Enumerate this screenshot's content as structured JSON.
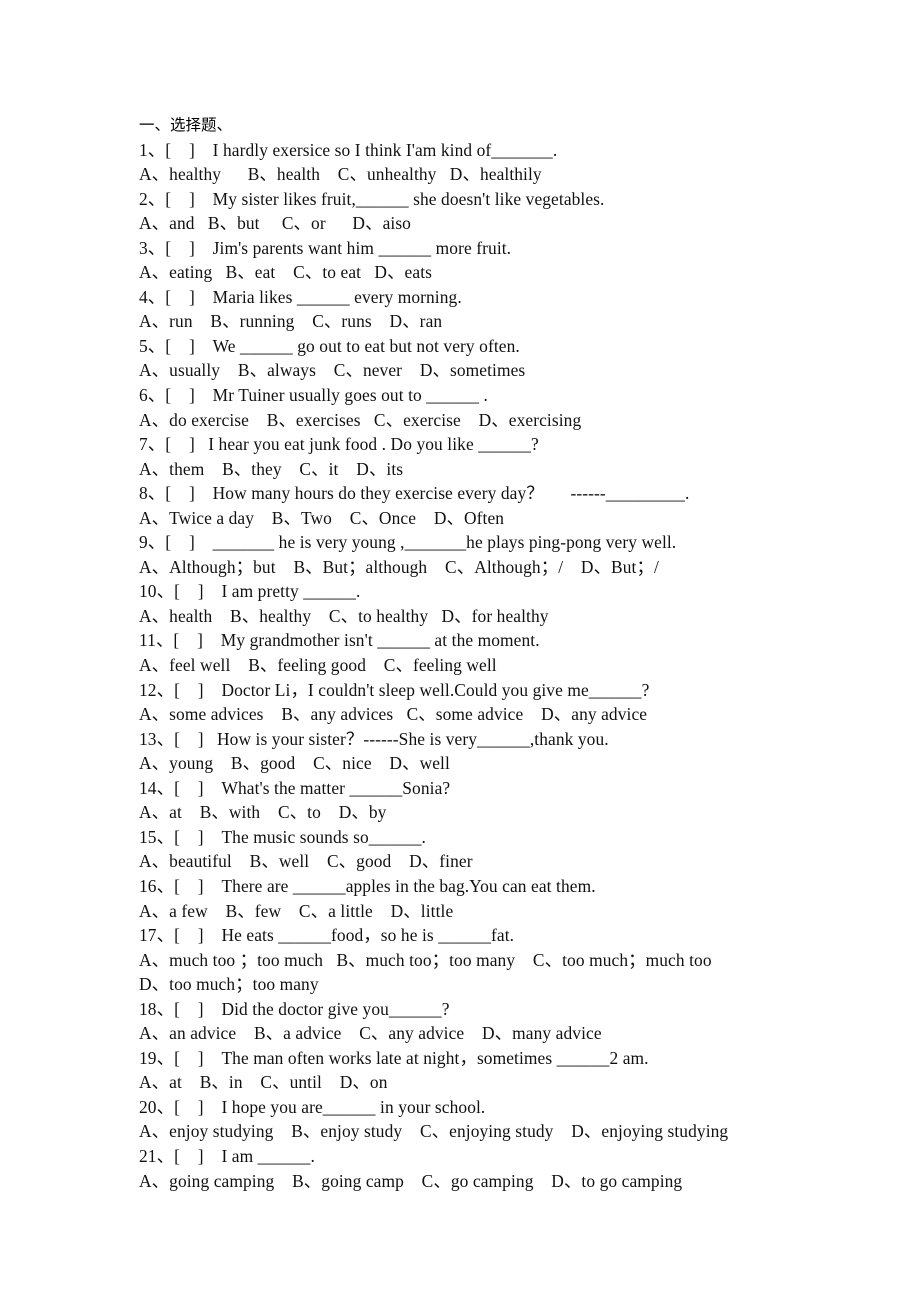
{
  "document": {
    "heading": "一、选择题、",
    "questions": [
      {
        "stem": "1、[    ]    I hardly exersice so I think I'am kind of_______.",
        "options": "A、healthy      B、health    C、unhealthy   D、healthily"
      },
      {
        "stem": "2、[    ]    My sister likes fruit,______ she doesn't like vegetables.",
        "options": "A、and   B、but     C、or      D、aiso"
      },
      {
        "stem": "3、[    ]    Jim's parents want him ______ more fruit.",
        "options": "A、eating   B、eat    C、to eat   D、eats"
      },
      {
        "stem": "4、[    ]    Maria likes ______ every morning.",
        "options": "A、run    B、running    C、runs    D、ran"
      },
      {
        "stem": "5、[    ]    We ______ go out to eat but not very often.",
        "options": "A、usually    B、always    C、never    D、sometimes"
      },
      {
        "stem": "6、[    ]    Mr Tuiner usually goes out to ______ .",
        "options": "A、do exercise    B、exercises   C、exercise    D、exercising"
      },
      {
        "stem": "7、[    ]   I hear you eat junk food . Do you like ______?",
        "options": "A、them    B、they    C、it    D、its"
      },
      {
        "stem": "8、[    ]    How many hours do they exercise every day？      ------_________.",
        "options": "A、Twice a day    B、Two    C、Once    D、Often"
      },
      {
        "stem": "9、[    ]    _______ he is very young ,_______he plays ping-pong very well.",
        "options": "A、Although；but    B、But；although    C、Although；/    D、But；/"
      },
      {
        "stem": "10、[    ]    I am pretty ______.",
        "options": "A、health    B、healthy    C、to healthy   D、for healthy"
      },
      {
        "stem": "11、[    ]    My grandmother isn't ______ at the moment.",
        "options": "A、feel well    B、feeling good    C、feeling well"
      },
      {
        "stem": "12、[    ]    Doctor Li，I couldn't sleep well.Could you give me______?",
        "options": "A、some advices    B、any advices   C、some advice    D、any advice"
      },
      {
        "stem": "13、[    ]   How is your sister？------She is very______,thank you.",
        "options": "A、young    B、good    C、nice    D、well"
      },
      {
        "stem": "14、[    ]    What's the matter ______Sonia?",
        "options": "A、at    B、with    C、to    D、by"
      },
      {
        "stem": "15、[    ]    The music sounds so______.",
        "options": "A、beautiful    B、well    C、good    D、finer"
      },
      {
        "stem": "16、[    ]    There are ______apples in the bag.You can eat them.",
        "options": "A、a few    B、few    C、a little    D、little"
      },
      {
        "stem": "17、[    ]    He eats ______food，so he is ______fat.",
        "options": "A、much too ；too much   B、much too；too many    C、too much；much too\nD、too much；too many"
      },
      {
        "stem": "18、[    ]    Did the doctor give you______?",
        "options": "A、an advice    B、a advice    C、any advice    D、many advice"
      },
      {
        "stem": "19、[    ]    The man often works late at night，sometimes ______2 am.",
        "options": "A、at    B、in    C、until    D、on"
      },
      {
        "stem": "20、[    ]    I hope you are______ in your school.",
        "options": "A、enjoy studying    B、enjoy study    C、enjoying study    D、enjoying studying"
      },
      {
        "stem": "21、[    ]    I am ______.",
        "options": "A、going camping    B、going camp    C、go camping    D、to go camping"
      }
    ]
  }
}
